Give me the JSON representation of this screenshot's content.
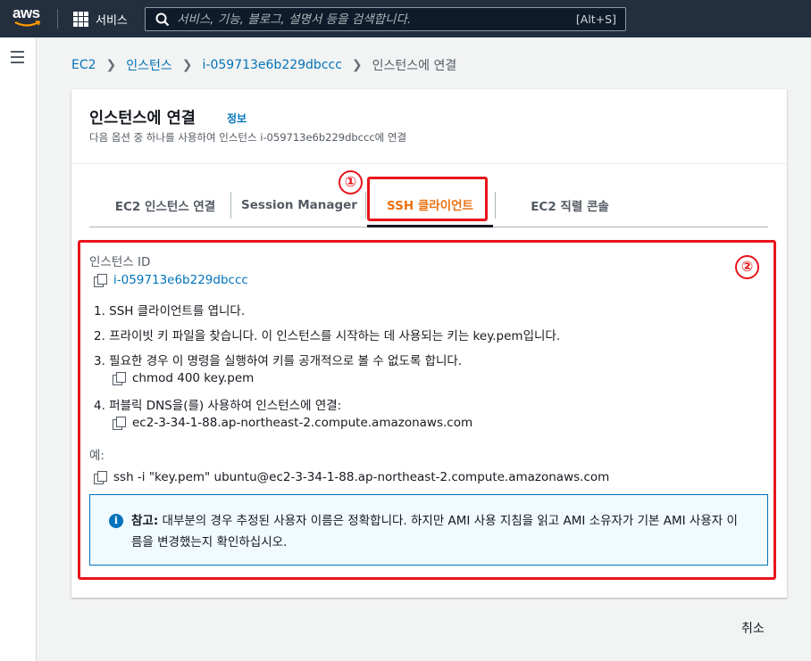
{
  "topbar": {
    "logo_text": "aws",
    "services_label": "서비스",
    "search_placeholder": "서비스, 기능, 블로그, 설명서 등을 검색합니다.",
    "search_shortcut": "[Alt+S]"
  },
  "breadcrumb": {
    "items": [
      "EC2",
      "인스턴스",
      "i-059713e6b229dbccc"
    ],
    "current": "인스턴스에 연결"
  },
  "header": {
    "title": "인스턴스에 연결",
    "info_link": "정보",
    "subtitle": "다음 옵션 중 하나를 사용하여 인스턴스 i-059713e6b229dbccc에 연결"
  },
  "tabs": [
    {
      "label": "EC2 인스턴스 연결",
      "active": false
    },
    {
      "label": "Session Manager",
      "active": false
    },
    {
      "label": "SSH 클라이언트",
      "active": true
    },
    {
      "label": "EC2 직렬 콘솔",
      "active": false
    }
  ],
  "ssh": {
    "instance_id_label": "인스턴스 ID",
    "instance_id": "i-059713e6b229dbccc",
    "steps": [
      "1. SSH 클라이언트를 엽니다.",
      "2. 프라이빗 키 파일을 찾습니다. 이 인스턴스를 시작하는 데 사용되는 키는 key.pem입니다.",
      "3. 필요한 경우 이 명령을 실행하여 키를 공개적으로 볼 수 없도록 합니다.",
      "4. 퍼블릭 DNS을(를) 사용하여 인스턴스에 연결:"
    ],
    "chmod_cmd": "chmod 400 key.pem",
    "public_dns": "ec2-3-34-1-88.ap-northeast-2.compute.amazonaws.com",
    "example_label": "예:",
    "example_cmd": "ssh -i \"key.pem\" ubuntu@ec2-3-34-1-88.ap-northeast-2.compute.amazonaws.com"
  },
  "note": {
    "label": "참고:",
    "text": "대부분의 경우 추정된 사용자 이름은 정확합니다. 하지만 AMI 사용 지침을 읽고 AMI 소유자가 기본 AMI 사용자 이름을 변경했는지 확인하십시오."
  },
  "footer": {
    "cancel_label": "취소"
  },
  "annotations": {
    "marker_1": "①",
    "marker_2": "②"
  },
  "colors": {
    "nav_bg": "#232f3e",
    "link": "#0073bb",
    "active_tab": "#ec7211",
    "annotation": "#e8141b"
  }
}
